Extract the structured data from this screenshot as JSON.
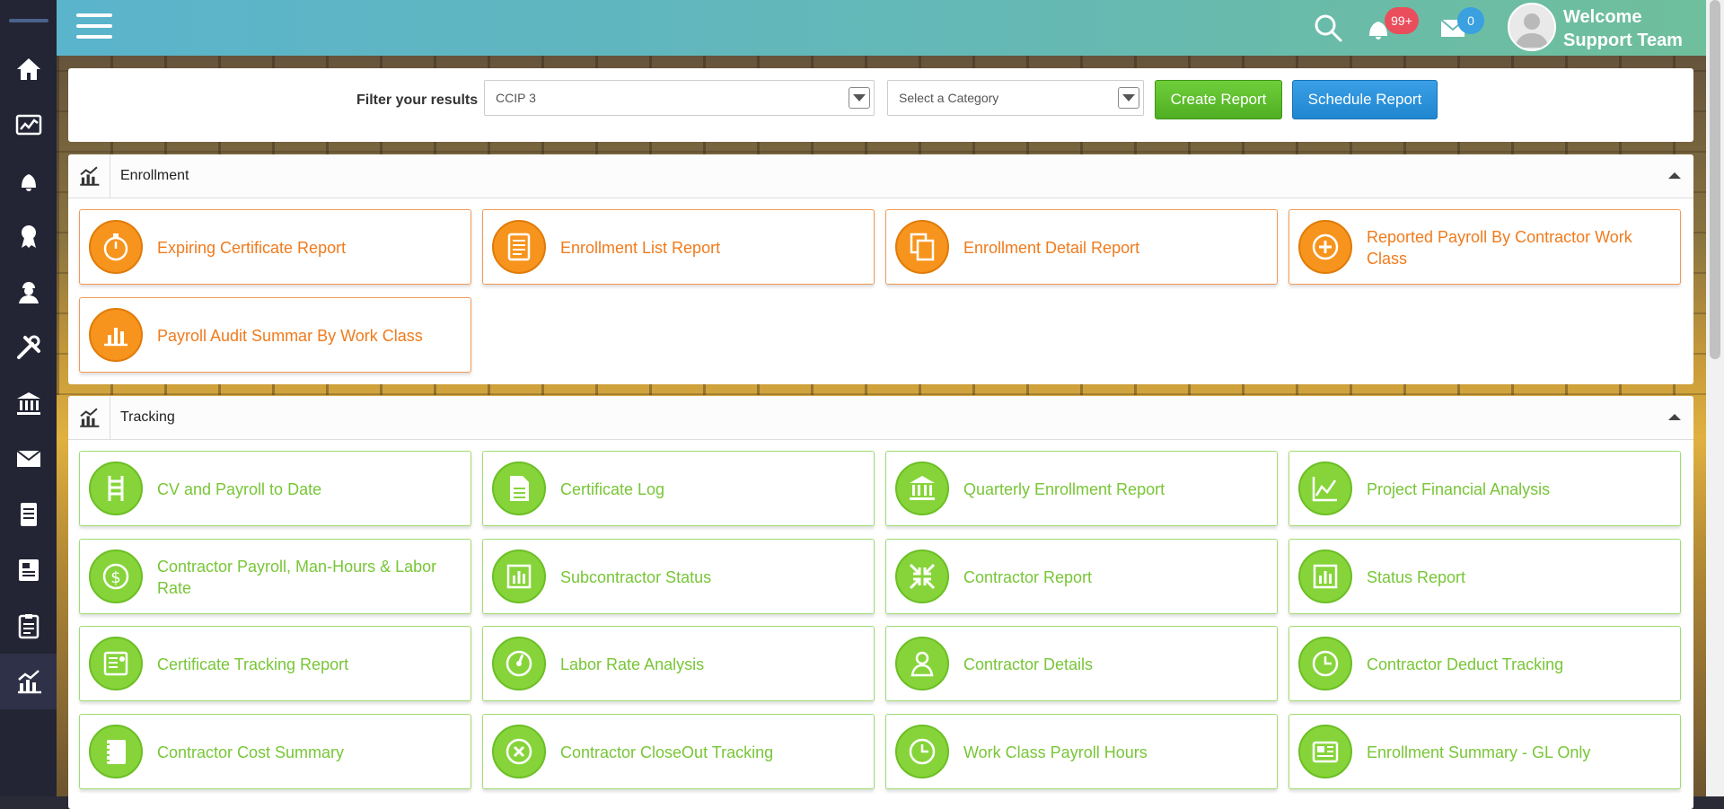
{
  "topbar": {
    "notifications_count": "99+",
    "messages_count": "0",
    "welcome_line1": "Welcome",
    "welcome_line2": "Support Team"
  },
  "sidebar": {
    "items": [
      {
        "icon": "home-icon"
      },
      {
        "icon": "dashboard-chart-icon"
      },
      {
        "icon": "bell-icon"
      },
      {
        "icon": "award-icon"
      },
      {
        "icon": "worker-icon"
      },
      {
        "icon": "tools-icon"
      },
      {
        "icon": "bank-icon"
      },
      {
        "icon": "mail-icon"
      },
      {
        "icon": "document-icon"
      },
      {
        "icon": "report-icon"
      },
      {
        "icon": "clipboard-icon"
      },
      {
        "icon": "analytics-icon",
        "active": true
      }
    ]
  },
  "filter": {
    "label": "Filter your results",
    "project_value": "CCIP 3",
    "category_placeholder": "Select a Category",
    "create_label": "Create Report",
    "schedule_label": "Schedule Report"
  },
  "enrollment": {
    "title": "Enrollment",
    "cards": [
      {
        "label": "Expiring Certificate Report",
        "icon": "stopwatch-icon"
      },
      {
        "label": "Enrollment List Report",
        "icon": "list-document-icon"
      },
      {
        "label": "Enrollment Detail Report",
        "icon": "copy-documents-icon"
      },
      {
        "label": "Reported Payroll By Contractor Work Class",
        "icon": "plus-circle-icon"
      },
      {
        "label": "Payroll Audit Summar By Work Class",
        "icon": "bar-chart-icon"
      }
    ]
  },
  "tracking": {
    "title": "Tracking",
    "cards": [
      {
        "label": "CV and Payroll to Date",
        "icon": "ladder-icon"
      },
      {
        "label": "Certificate Log",
        "icon": "file-icon"
      },
      {
        "label": "Quarterly Enrollment Report",
        "icon": "bank-icon"
      },
      {
        "label": "Project Financial Analysis",
        "icon": "line-chart-icon"
      },
      {
        "label": "Contractor Payroll, Man-Hours & Labor Rate",
        "icon": "dollar-icon"
      },
      {
        "label": "Subcontractor Status",
        "icon": "chart-frame-icon"
      },
      {
        "label": "Contractor Report",
        "icon": "compress-icon"
      },
      {
        "label": "Status Report",
        "icon": "chart-frame-icon"
      },
      {
        "label": "Certificate Tracking Report",
        "icon": "certificate-icon"
      },
      {
        "label": "Labor Rate Analysis",
        "icon": "gauge-icon"
      },
      {
        "label": "Contractor Details",
        "icon": "person-icon"
      },
      {
        "label": "Contractor Deduct Tracking",
        "icon": "clock-icon"
      },
      {
        "label": "Contractor Cost Summary",
        "icon": "notebook-icon"
      },
      {
        "label": "Contractor CloseOut Tracking",
        "icon": "close-circle-icon"
      },
      {
        "label": "Work Class Payroll Hours",
        "icon": "clock-icon"
      },
      {
        "label": "Enrollment Summary - GL Only",
        "icon": "newspaper-icon"
      }
    ]
  },
  "colors": {
    "orange_accent": "#f07b1d",
    "green_accent": "#78c637",
    "create_button": "#4fae22",
    "schedule_button": "#1f86d0",
    "sidebar_bg": "#232434"
  }
}
